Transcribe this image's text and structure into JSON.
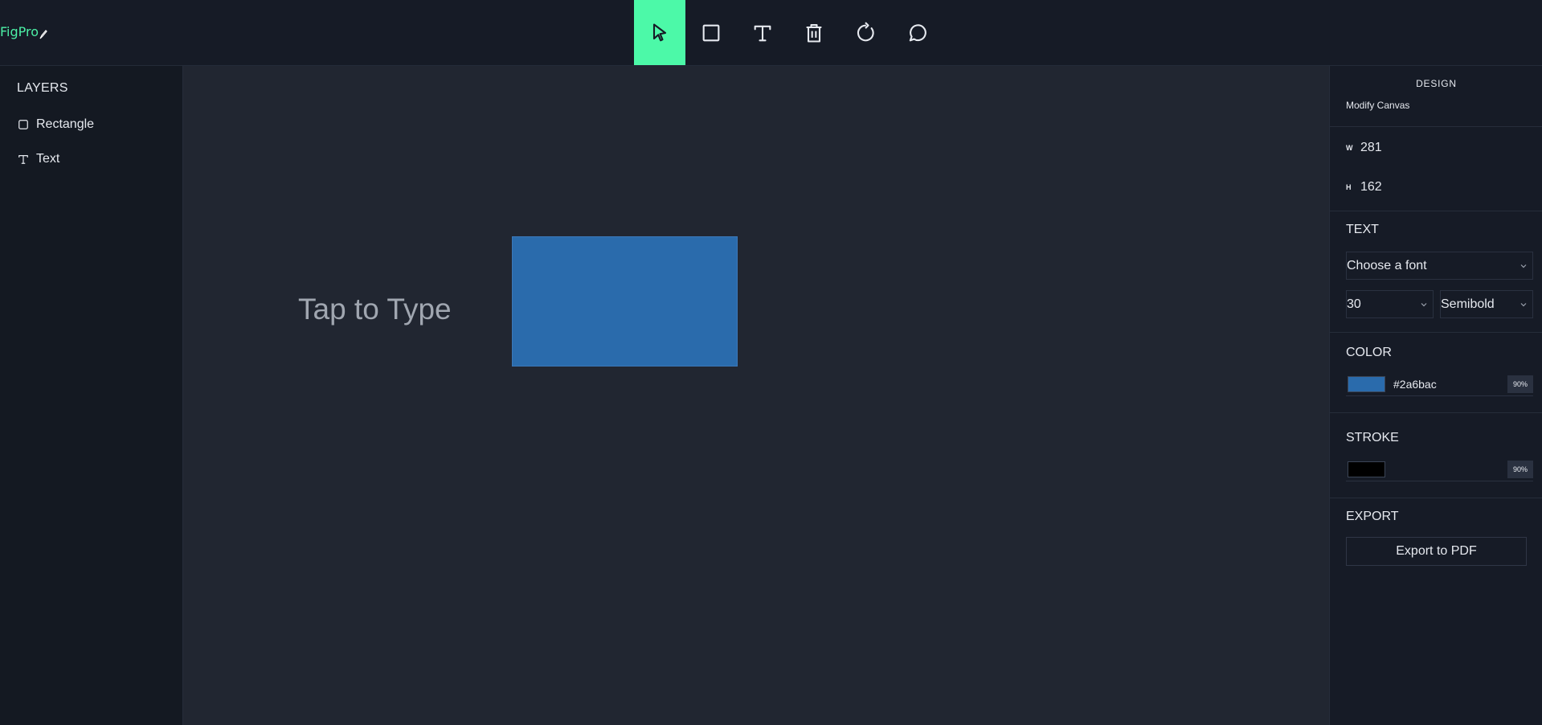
{
  "app": {
    "logo_text": "FigPro"
  },
  "toolbar": {
    "tools": [
      {
        "icon": "cursor-icon",
        "active": true
      },
      {
        "icon": "rectangle-icon",
        "active": false
      },
      {
        "icon": "text-icon",
        "active": false
      },
      {
        "icon": "trash-icon",
        "active": false
      },
      {
        "icon": "reset-icon",
        "active": false
      },
      {
        "icon": "comment-icon",
        "active": false
      }
    ],
    "active_color": "#4cf9a8"
  },
  "layers": {
    "title": "LAYERS",
    "items": [
      {
        "label": "Rectangle",
        "icon": "square-icon"
      },
      {
        "label": "Text",
        "icon": "text-icon"
      }
    ]
  },
  "canvas": {
    "text": "Tap to Type",
    "rect_fill": "#2a6bac"
  },
  "design": {
    "title": "DESIGN",
    "subtitle": "Modify Canvas",
    "width_label": "W",
    "width_value": "281",
    "height_label": "H",
    "height_value": "162",
    "text_section": {
      "title": "TEXT",
      "font_placeholder": "Choose a font",
      "size": "30",
      "weight": "Semibold"
    },
    "color_section": {
      "title": "COLOR",
      "swatch": "#2a6bac",
      "hex": "#2a6bac",
      "opacity": "90%"
    },
    "stroke_section": {
      "title": "STROKE",
      "swatch": "#000000",
      "opacity": "90%"
    },
    "export_section": {
      "title": "EXPORT",
      "button": "Export to PDF"
    }
  }
}
